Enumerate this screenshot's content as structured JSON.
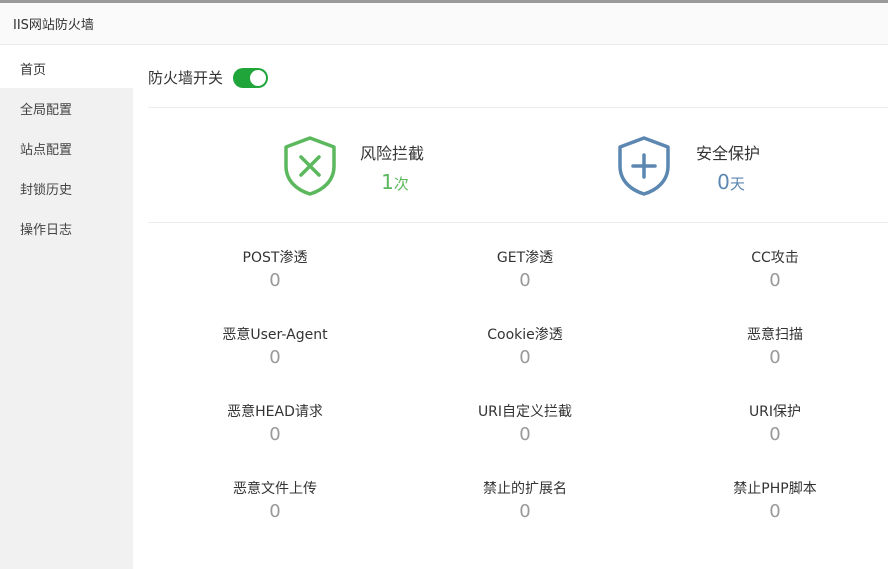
{
  "window": {
    "title": "IIS网站防火墙"
  },
  "sidebar": {
    "items": [
      {
        "label": "首页"
      },
      {
        "label": "全局配置"
      },
      {
        "label": "站点配置"
      },
      {
        "label": "封锁历史"
      },
      {
        "label": "操作日志"
      }
    ],
    "active_index": 0
  },
  "firewall_toggle": {
    "label": "防火墙开关",
    "state": "on",
    "color": "#20a53a"
  },
  "summary": {
    "risk_block": {
      "title": "风险拦截",
      "value": "1",
      "unit": "次",
      "color": "#5cb85c",
      "icon": "shield-x-icon"
    },
    "security_protection": {
      "title": "安全保护",
      "value": "0",
      "unit": "天",
      "color": "#5b87b1",
      "icon": "shield-plus-icon"
    }
  },
  "stats": [
    {
      "label": "POST渗透",
      "value": "0"
    },
    {
      "label": "GET渗透",
      "value": "0"
    },
    {
      "label": "CC攻击",
      "value": "0"
    },
    {
      "label": "恶意User-Agent",
      "value": "0"
    },
    {
      "label": "Cookie渗透",
      "value": "0"
    },
    {
      "label": "恶意扫描",
      "value": "0"
    },
    {
      "label": "恶意HEAD请求",
      "value": "0"
    },
    {
      "label": "URI自定义拦截",
      "value": "0"
    },
    {
      "label": "URI保护",
      "value": "0"
    },
    {
      "label": "恶意文件上传",
      "value": "0"
    },
    {
      "label": "禁止的扩展名",
      "value": "0"
    },
    {
      "label": "禁止PHP脚本",
      "value": "0"
    }
  ]
}
